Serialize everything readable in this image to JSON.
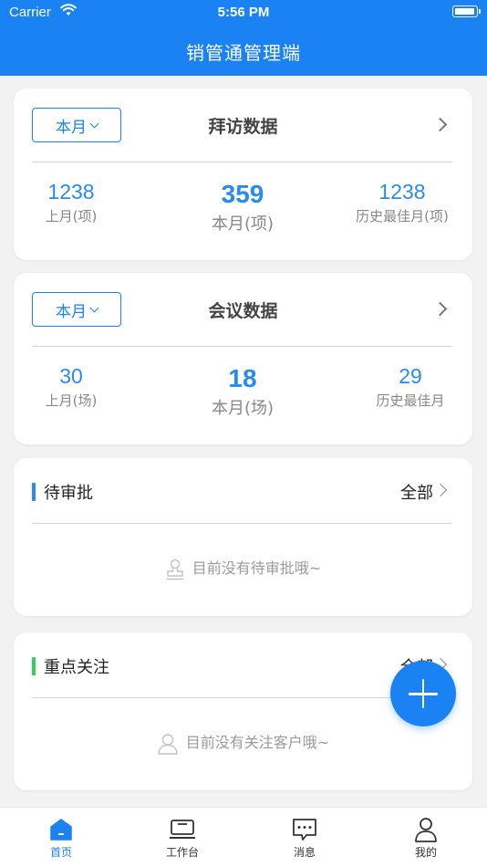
{
  "status_bar": {
    "carrier": "Carrier",
    "time": "5:56 PM"
  },
  "header": {
    "title": "销管通管理端"
  },
  "visit_card": {
    "period": "本月",
    "title": "拜访数据",
    "stats": [
      {
        "value": "1238",
        "label": "上月(项)"
      },
      {
        "value": "359",
        "label": "本月(项)"
      },
      {
        "value": "1238",
        "label": "历史最佳月(项)"
      }
    ]
  },
  "meeting_card": {
    "period": "本月",
    "title": "会议数据",
    "stats": [
      {
        "value": "30",
        "label": "上月(场)"
      },
      {
        "value": "18",
        "label": "本月(场)"
      },
      {
        "value": "29",
        "label": "历史最佳月"
      }
    ]
  },
  "pending_card": {
    "title": "待审批",
    "all_label": "全部",
    "empty_text": "目前没有待审批哦~",
    "accent": "#2a8bef"
  },
  "focus_card": {
    "title": "重点关注",
    "all_label": "全部",
    "empty_text": "目前没有关注客户哦~",
    "accent": "#2ed15a"
  },
  "tabbar": {
    "items": [
      {
        "label": "首页",
        "icon": "home-icon",
        "active": true
      },
      {
        "label": "工作台",
        "icon": "laptop-icon",
        "active": false
      },
      {
        "label": "消息",
        "icon": "message-icon",
        "active": false
      },
      {
        "label": "我的",
        "icon": "user-icon",
        "active": false
      }
    ]
  },
  "colors": {
    "primary": "#1a82f2",
    "stat_number": "#2a8bef"
  }
}
